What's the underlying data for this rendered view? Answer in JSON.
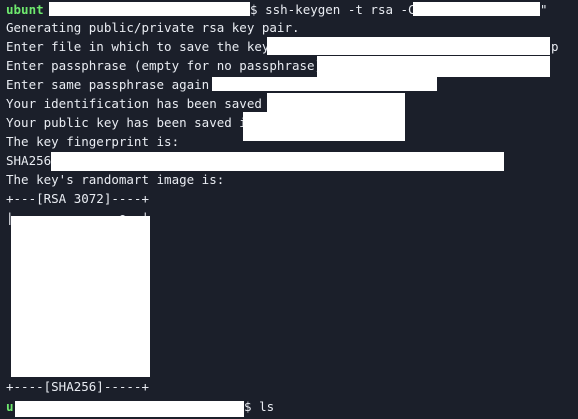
{
  "prompt1": {
    "user_fragment": "ubunt",
    "suffix": "$ ",
    "command": "ssh-keygen -t rsa -C \"",
    "command_close": "\""
  },
  "output": {
    "generating": "Generating public/private rsa key pair.",
    "enter_file": "Enter file in which to save the key (",
    "enter_file_tail": "p",
    "enter_passphrase": "Enter passphrase (empty for no passphrase):",
    "enter_same": "Enter same passphrase again:",
    "id_saved": "Your identification has been saved in",
    "pub_saved": "Your public key has been saved in",
    "fingerprint_is": "The key fingerprint is:",
    "sha_prefix": "SHA256:",
    "randomart_is": "The key's randomart image is:",
    "art_top": "+---[RSA 3072]----+",
    "art_row1": "|              o  |",
    "art_bottom": "+----[SHA256]-----+"
  },
  "prompt2": {
    "user_fragment": "u",
    "suffix": "$ ",
    "command": "ls"
  },
  "colors": {
    "background": "#1b1f2a",
    "text": "#e9ecf2",
    "prompt_user": "#6ee86e",
    "redaction": "#ffffff"
  }
}
